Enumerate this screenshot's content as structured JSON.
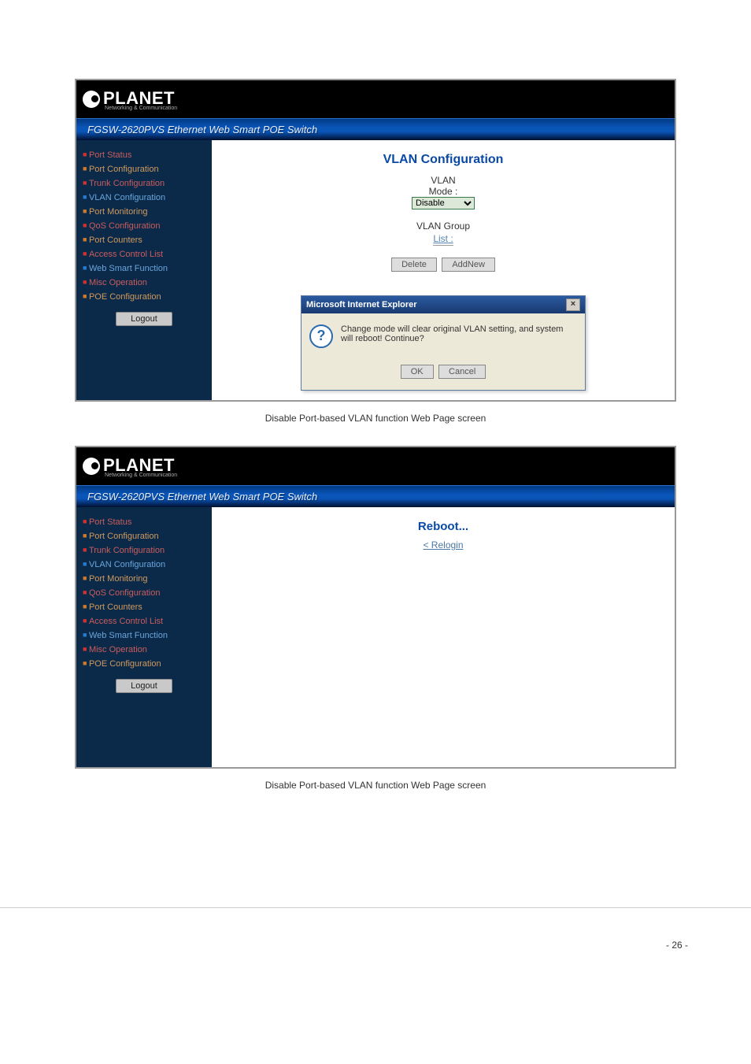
{
  "logo_text": "PLANET",
  "logo_sub": "Networking & Communication",
  "banner_title": "FGSW-2620PVS Ethernet Web Smart POE Switch",
  "sidebar": {
    "items": [
      {
        "label": "Port Status",
        "cls": "c-red"
      },
      {
        "label": "Port Configuration",
        "cls": "c-orange"
      },
      {
        "label": "Trunk Configuration",
        "cls": "c-red"
      },
      {
        "label": "VLAN Configuration",
        "cls": "c-blue"
      },
      {
        "label": "Port Monitoring",
        "cls": "c-orange"
      },
      {
        "label": "QoS Configuration",
        "cls": "c-red"
      },
      {
        "label": "Port Counters",
        "cls": "c-orange"
      },
      {
        "label": "Access Control List",
        "cls": "c-red"
      },
      {
        "label": "Web Smart Function",
        "cls": "c-blue"
      },
      {
        "label": "Misc Operation",
        "cls": "c-red"
      },
      {
        "label": "POE Configuration",
        "cls": "c-orange"
      }
    ],
    "logout": "Logout"
  },
  "vlan": {
    "heading": "VLAN Configuration",
    "mode_lbl1": "VLAN",
    "mode_lbl2": "Mode :",
    "mode_value": "Disable",
    "group_lbl": "VLAN Group",
    "list_link": "List :",
    "delete_btn": "Delete",
    "addnew_btn": "AddNew"
  },
  "dialog": {
    "title": "Microsoft Internet Explorer",
    "message": "Change mode will clear original VLAN setting, and system will reboot! Continue?",
    "ok": "OK",
    "cancel": "Cancel"
  },
  "caption1": "Disable Port-based VLAN function Web Page screen",
  "reboot": {
    "title": "Reboot...",
    "relogin": "< Relogin"
  },
  "caption2": "Disable Port-based VLAN function Web Page screen",
  "page_num": "- 26 -"
}
